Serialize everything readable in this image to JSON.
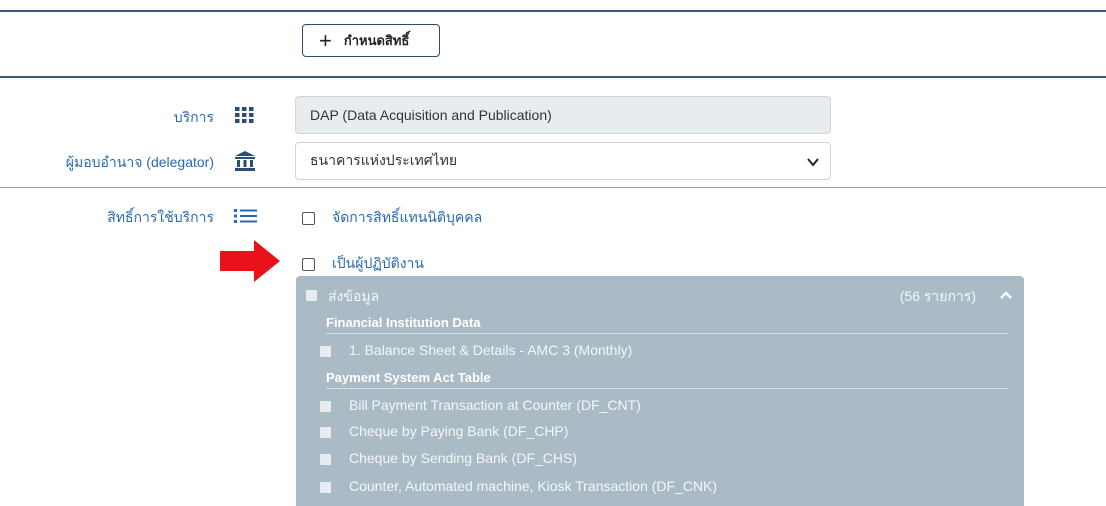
{
  "toolbar": {
    "add_label": "กำหนดสิทธิ์"
  },
  "form": {
    "service_label": "บริการ",
    "service_value": "DAP (Data Acquisition and Publication)",
    "delegator_label": "ผู้มอบอำนาจ (delegator)",
    "delegator_value": "ธนาคารแห่งประเทศไทย",
    "rights_label": "สิทธิ์การใช้บริการ"
  },
  "options": {
    "manage_rights": "จัดการสิทธิ์แทนนิติบุคคล",
    "operator": "เป็นผู้ปฏิบัติงาน"
  },
  "panel": {
    "title": "ส่งข้อมูล",
    "count": "(56 รายการ)",
    "groups": [
      {
        "title": "Financial Institution Data",
        "items": [
          "1. Balance Sheet & Details - AMC 3 (Monthly)"
        ]
      },
      {
        "title": "Payment System Act Table",
        "items": [
          "Bill Payment Transaction at Counter (DF_CNT)",
          "Cheque by Paying Bank (DF_CHP)",
          "Cheque by Sending Bank (DF_CHS)",
          "Counter, Automated machine, Kiosk Transaction (DF_CNK)"
        ]
      }
    ]
  },
  "colors": {
    "accent": "#2a6ab3",
    "panel_bg": "#aabbc5",
    "arrow": "#e8121b",
    "border": "#3d5a80"
  },
  "icons": [
    "plus-icon",
    "grid-icon",
    "bank-icon",
    "list-icon",
    "chevron-down-icon",
    "chevron-up-icon",
    "red-arrow-icon"
  ]
}
